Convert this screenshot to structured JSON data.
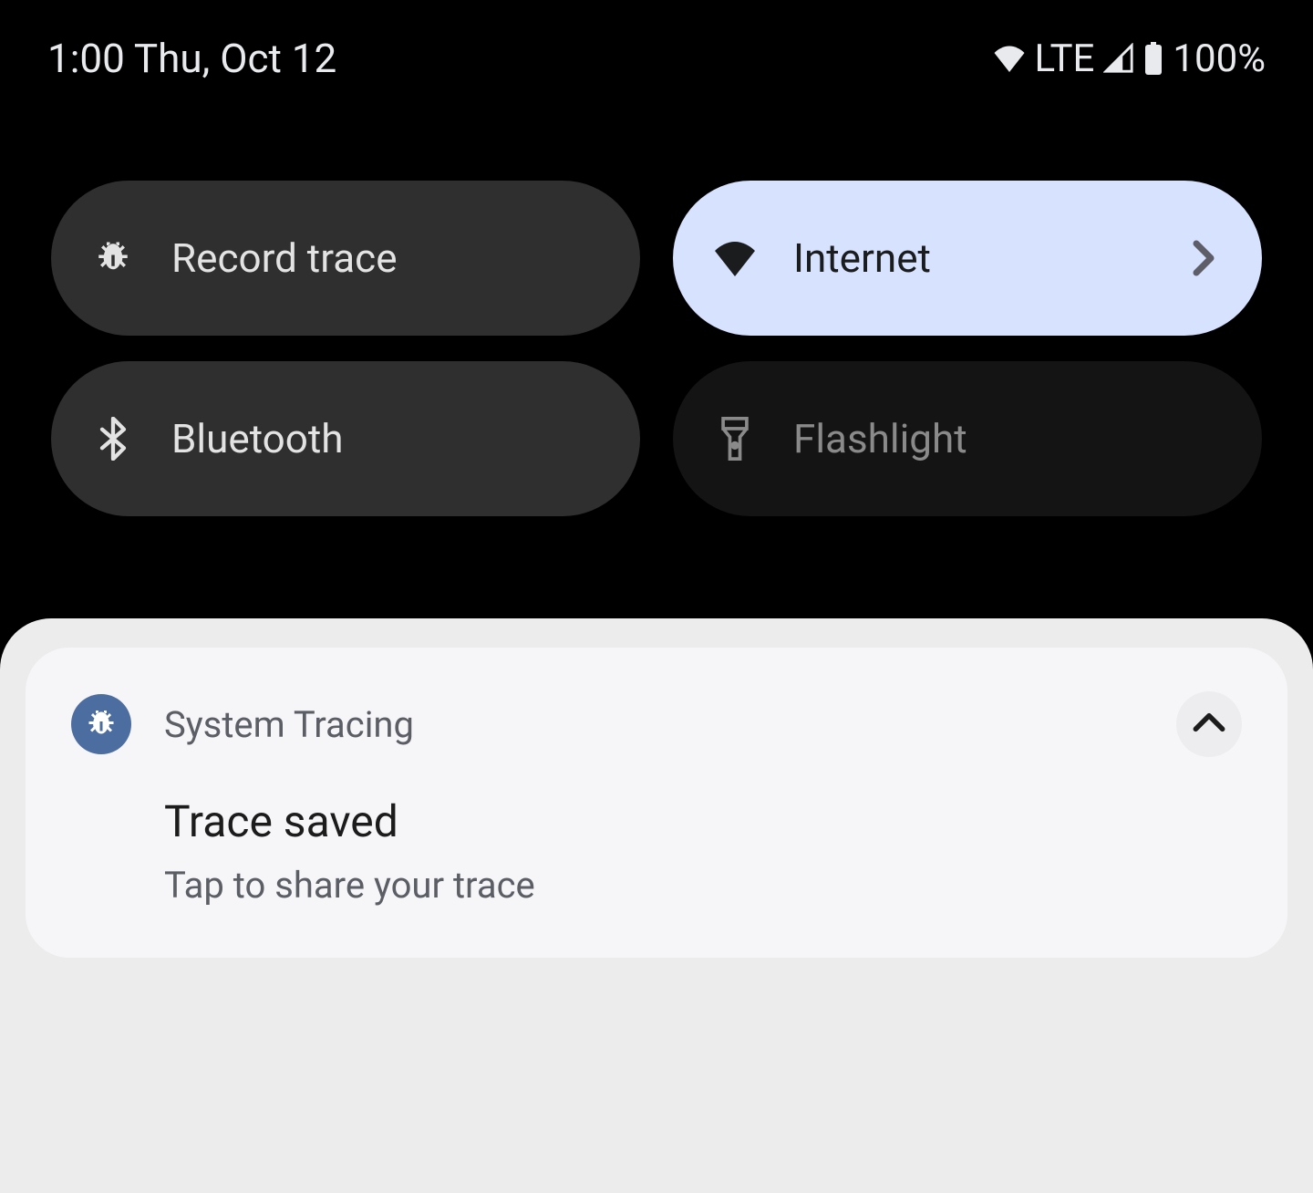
{
  "status": {
    "time_date": "1:00 Thu, Oct 12",
    "network_label": "LTE",
    "battery_percent": "100%"
  },
  "quick_settings": {
    "tiles": [
      {
        "id": "record-trace",
        "label": "Record trace",
        "state": "inactive",
        "icon": "bug-icon",
        "has_chevron": false
      },
      {
        "id": "internet",
        "label": "Internet",
        "state": "active",
        "icon": "wifi-icon",
        "has_chevron": true
      },
      {
        "id": "bluetooth",
        "label": "Bluetooth",
        "state": "inactive",
        "icon": "bluetooth-icon",
        "has_chevron": false
      },
      {
        "id": "flashlight",
        "label": "Flashlight",
        "state": "disabled",
        "icon": "flashlight-icon",
        "has_chevron": false
      }
    ]
  },
  "notification": {
    "app_name": "System Tracing",
    "title": "Trace saved",
    "subtitle": "Tap to share your trace"
  }
}
